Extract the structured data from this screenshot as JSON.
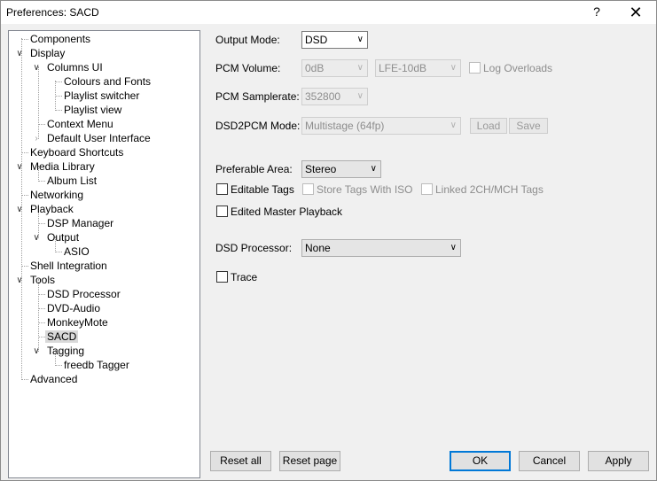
{
  "window": {
    "title": "Preferences: SACD",
    "help_glyph": "?",
    "close_glyph": "✕"
  },
  "tree": {
    "items": [
      {
        "label": "Components"
      },
      {
        "label": "Display"
      },
      {
        "label": "Columns UI"
      },
      {
        "label": "Colours and Fonts"
      },
      {
        "label": "Playlist switcher"
      },
      {
        "label": "Playlist view"
      },
      {
        "label": "Context Menu"
      },
      {
        "label": "Default User Interface"
      },
      {
        "label": "Keyboard Shortcuts"
      },
      {
        "label": "Media Library"
      },
      {
        "label": "Album List"
      },
      {
        "label": "Networking"
      },
      {
        "label": "Playback"
      },
      {
        "label": "DSP Manager"
      },
      {
        "label": "Output"
      },
      {
        "label": "ASIO"
      },
      {
        "label": "Shell Integration"
      },
      {
        "label": "Tools"
      },
      {
        "label": "DSD Processor"
      },
      {
        "label": "DVD-Audio"
      },
      {
        "label": "MonkeyMote"
      },
      {
        "label": "SACD"
      },
      {
        "label": "Tagging"
      },
      {
        "label": "freedb Tagger"
      },
      {
        "label": "Advanced"
      }
    ]
  },
  "form": {
    "output_mode": {
      "label": "Output Mode:",
      "value": "DSD"
    },
    "pcm_volume": {
      "label": "PCM Volume:",
      "value": "0dB",
      "lfe_value": "LFE-10dB",
      "log_overloads": "Log Overloads"
    },
    "pcm_samplerate": {
      "label": "PCM Samplerate:",
      "value": "352800"
    },
    "dsd2pcm_mode": {
      "label": "DSD2PCM Mode:",
      "value": "Multistage (64fp)",
      "load": "Load",
      "save": "Save"
    },
    "preferable_area": {
      "label": "Preferable Area:",
      "value": "Stereo"
    },
    "editable_tags": "Editable Tags",
    "store_tags_iso": "Store Tags With ISO",
    "linked_tags": "Linked 2CH/MCH Tags",
    "edited_master": "Edited Master Playback",
    "dsd_processor": {
      "label": "DSD Processor:",
      "value": "None"
    },
    "trace": "Trace"
  },
  "buttons": {
    "reset_all": "Reset all",
    "reset_page": "Reset page",
    "ok": "OK",
    "cancel": "Cancel",
    "apply": "Apply"
  }
}
